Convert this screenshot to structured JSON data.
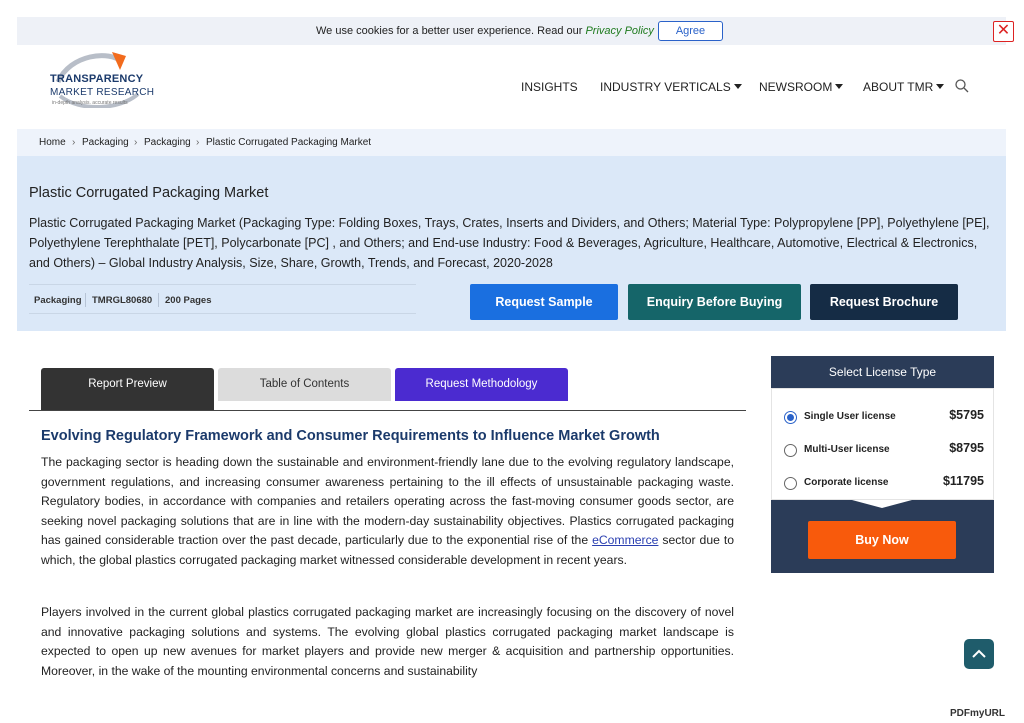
{
  "cookie": {
    "text": "We use cookies for a better user experience. Read our ",
    "link": "Privacy Policy",
    "agree": "Agree",
    "close_icon": "close-icon"
  },
  "logo": {
    "line1": "TRANSPARENCY",
    "line2": "MARKET RESEARCH",
    "tagline": "in-depth analysis. accurate results"
  },
  "nav": {
    "insights": "INSIGHTS",
    "industry": "INDUSTRY VERTICALS",
    "newsroom": "NEWSROOM",
    "about": "ABOUT TMR",
    "search_icon": "search-icon"
  },
  "breadcrumb": [
    "Home",
    "Packaging",
    "Packaging",
    "Plastic Corrugated Packaging Market"
  ],
  "hero": {
    "title": "Plastic Corrugated Packaging Market",
    "description": "Plastic Corrugated Packaging Market (Packaging Type: Folding Boxes, Trays, Crates, Inserts and Dividers, and Others; Material Type: Polypropylene [PP], Polyethylene [PE], Polyethylene Terephthalate [PET], Polycarbonate [PC] , and Others; and End-use Industry: Food & Beverages, Agriculture, Healthcare, Automotive, Electrical & Electronics, and Others) – Global Industry Analysis, Size, Share, Growth, Trends, and Forecast, 2020-2028",
    "meta": [
      "Packaging",
      "TMRGL80680",
      "200 Pages"
    ],
    "buttons": {
      "sample": "Request Sample",
      "enquiry": "Enquiry Before Buying",
      "brochure": "Request Brochure"
    }
  },
  "tabs": {
    "preview": "Report Preview",
    "toc": "Table of Contents",
    "methodology": "Request Methodology"
  },
  "article": {
    "heading": "Evolving Regulatory Framework and Consumer Requirements to Influence Market Growth",
    "p1_a": "The packaging sector is heading down the sustainable and environment-friendly lane due to the evolving regulatory landscape, government regulations, and increasing consumer awareness pertaining to the ill effects of unsustainable packaging waste. Regulatory bodies, in accordance with companies and retailers operating across the fast-moving consumer goods sector, are seeking novel packaging solutions that are in line with the modern-day sustainability objectives. Plastics corrugated packaging has gained considerable traction over the past decade, particularly due to the exponential rise of the ",
    "p1_link": "eCommerce",
    "p1_b": " sector due to which, the global plastics corrugated packaging market witnessed considerable development in recent years.",
    "p2": "Players involved in the current global plastics corrugated packaging market are increasingly focusing on the discovery of novel and innovative packaging solutions and systems. The evolving global plastics corrugated packaging market landscape is expected to open up new avenues for market players and provide new merger & acquisition and partnership opportunities. Moreover, in the wake of the mounting environmental concerns and sustainability"
  },
  "license": {
    "title": "Select License Type",
    "options": [
      {
        "label": "Single User license",
        "price": "$5795",
        "selected": true
      },
      {
        "label": "Multi-User license",
        "price": "$8795",
        "selected": false
      },
      {
        "label": "Corporate license",
        "price": "$11795",
        "selected": false
      }
    ],
    "buy": "Buy Now"
  },
  "watermark": "PDFmyURL",
  "colors": {
    "accent": "#2a62c9",
    "sample_btn": "#1a6fe0",
    "enquiry_btn": "#156569",
    "brochure_btn": "#152c45",
    "buy_btn": "#f85a0c",
    "methodology_tab": "#4b2bd0"
  }
}
